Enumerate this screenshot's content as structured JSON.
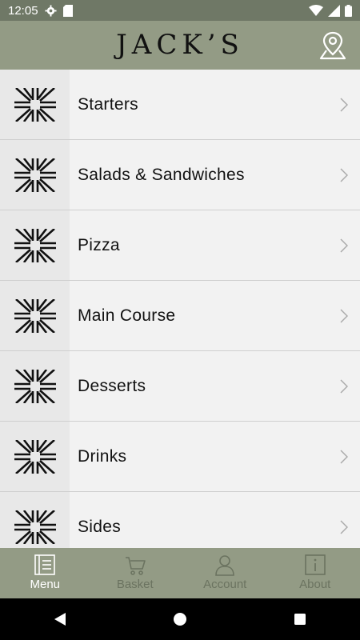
{
  "status_bar": {
    "time": "12:05"
  },
  "header": {
    "logo": "JACK’S"
  },
  "menu": {
    "items": [
      {
        "label": "Starters"
      },
      {
        "label": "Salads & Sandwiches"
      },
      {
        "label": "Pizza"
      },
      {
        "label": "Main Course"
      },
      {
        "label": "Desserts"
      },
      {
        "label": "Drinks"
      },
      {
        "label": "Sides"
      }
    ]
  },
  "bottom_nav": {
    "items": [
      {
        "label": "Menu",
        "icon": "menu-book-icon",
        "active": true
      },
      {
        "label": "Basket",
        "icon": "cart-icon",
        "active": false
      },
      {
        "label": "Account",
        "icon": "person-icon",
        "active": false
      },
      {
        "label": "About",
        "icon": "info-icon",
        "active": false
      }
    ]
  },
  "colors": {
    "status_bar": "#6f7866",
    "header": "#939b85",
    "nav_active": "#ffffff",
    "nav_inactive": "#6b7360",
    "row_background": "#f2f2f2"
  }
}
